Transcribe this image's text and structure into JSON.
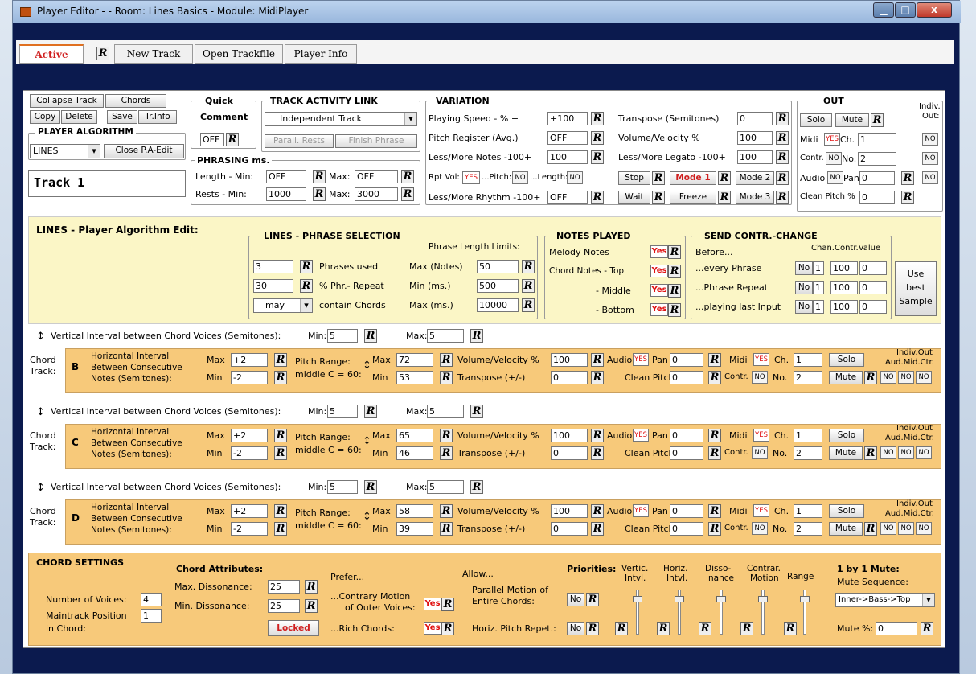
{
  "window": {
    "title": "Player Editor - - Room: Lines Basics - Module: MidiPlayer",
    "minimize": "▁",
    "maximize": "□",
    "close": "x"
  },
  "tabs": {
    "active": "Active",
    "r": "R",
    "new_track": "New Track",
    "open_trackfile": "Open Trackfile",
    "player_info": "Player Info"
  },
  "common": {
    "r": "R",
    "yes": "YES",
    "no": "NO",
    "Yes": "Yes",
    "No": "No"
  },
  "top": {
    "collapse": "Collapse Track",
    "chords": "Chords",
    "copy": "Copy",
    "delete": "Delete",
    "save": "Save",
    "trinfo": "Tr.Info",
    "algo_title": "PLAYER ALGORITHM",
    "algo_value": "LINES",
    "close_pa": "Close P.A-Edit",
    "track_name": "Track 1",
    "quick": "Quick",
    "comment": "Comment",
    "comment_val": "OFF",
    "tal_title": "TRACK ACTIVITY LINK",
    "tal_value": "Independent Track",
    "parall": "Parall. Rests",
    "finish": "Finish Phrase",
    "phr_title": "PHRASING ms.",
    "length": "Length - Min:",
    "rests": "Rests - Min:",
    "max": "Max:",
    "len_min": "OFF",
    "len_max": "OFF",
    "rest_min": "1000",
    "rest_max": "3000",
    "var_title": "VARIATION",
    "speed": "Playing Speed - % +",
    "speed_v": "+100",
    "pitchreg": "Pitch Register (Avg.)",
    "pitchreg_v": "OFF",
    "lessmore": "Less/More Notes -100+",
    "lessmore_v": "100",
    "rptvol": "Rpt Vol:",
    "pitch": "...Pitch:",
    "length2": "...Length:",
    "rhythm": "Less/More Rhythm -100+",
    "rhythm_v": "OFF",
    "transpose": "Transpose (Semitones)",
    "transpose_v": "0",
    "volvel": "Volume/Velocity %",
    "volvel_v": "100",
    "legato": "Less/More Legato -100+",
    "legato_v": "100",
    "stop": "Stop",
    "wait": "Wait",
    "mode1": "Mode 1",
    "freeze": "Freeze",
    "mode2": "Mode 2",
    "mode3": "Mode 3",
    "out_title": "OUT",
    "solo": "Solo",
    "mute": "Mute",
    "indiv": "Indiv.",
    "out2": "Out:",
    "midi": "Midi",
    "ch": "Ch.",
    "ch_v": "1",
    "contr": "Contr.",
    "no_l": "No.",
    "no_v": "2",
    "audio": "Audio",
    "pan": "Pan",
    "pan_v": "0",
    "cleanpitch": "Clean Pitch %",
    "cleanpitch_v": "0"
  },
  "lines": {
    "title": "LINES - Player Algorithm Edit:",
    "ps_title": "LINES - PHRASE SELECTION",
    "limits": "Phrase Length Limits:",
    "phrases_v": "3",
    "phrases": "Phrases used",
    "repeat_v": "30",
    "repeat": "% Phr.- Repeat",
    "may": "may",
    "contain": "contain Chords",
    "maxnotes": "Max (Notes)",
    "maxnotes_v": "50",
    "minms": "Min (ms.)",
    "minms_v": "500",
    "maxms": "Max (ms.)",
    "maxms_v": "10000",
    "np_title": "NOTES PLAYED",
    "melody": "Melody Notes",
    "top": "Chord Notes - Top",
    "middle": "- Middle",
    "bottom": "- Bottom",
    "sc_title": "SEND CONTR.-CHANGE",
    "before": "Before...",
    "chanhdr": "Chan.Contr.Value",
    "every": "...every Phrase",
    "prepeat": "...Phrase Repeat",
    "lastinput": "...playing last Input",
    "use": "Use",
    "best": "best",
    "sample": "Sample",
    "ch_v": "1",
    "contr_v": "100",
    "val_v": "0"
  },
  "vi": {
    "label": "Vertical Interval between Chord Voices (Semitones):",
    "min": "Min:",
    "max": "Max:"
  },
  "chordrow": {
    "chord": "Chord",
    "track": "Track:",
    "h1": "Horizontal Interval",
    "h2": "Between Consecutive",
    "h3": "Notes (Semitones):",
    "max": "Max",
    "min": "Min",
    "pr": "Pitch Range:",
    "middlec": "middle C = 60:",
    "vol": "Volume/Velocity %",
    "transp": "Transpose (+/-)",
    "audio": "Audio",
    "pan": "Pan",
    "clean": "Clean Pitch",
    "midi": "Midi",
    "ch": "Ch.",
    "contr": "Contr.",
    "no": "No.",
    "solo": "Solo",
    "mute": "Mute",
    "indivout": "Indiv.Out",
    "amc": "Aud.Mid.Ctr."
  },
  "tracks": [
    {
      "letter": "B",
      "vi_min": "5",
      "vi_max": "5",
      "hmax": "+2",
      "hmin": "-2",
      "pmax": "72",
      "pmin": "53",
      "vol": "100",
      "transp": "0",
      "pan": "0",
      "clean": "0",
      "ch": "1",
      "no": "2"
    },
    {
      "letter": "C",
      "vi_min": "5",
      "vi_max": "5",
      "hmax": "+2",
      "hmin": "-2",
      "pmax": "65",
      "pmin": "46",
      "vol": "100",
      "transp": "0",
      "pan": "0",
      "clean": "0",
      "ch": "1",
      "no": "2"
    },
    {
      "letter": "D",
      "vi_min": "5",
      "vi_max": "5",
      "hmax": "+2",
      "hmin": "-2",
      "pmax": "58",
      "pmin": "39",
      "vol": "100",
      "transp": "0",
      "pan": "0",
      "clean": "0",
      "ch": "1",
      "no": "2"
    }
  ],
  "cs": {
    "title": "CHORD SETTINGS",
    "voices": "Number of Voices:",
    "voices_v": "4",
    "mtp1": "Maintrack Position",
    "mtp_v": "1",
    "mtp2": "in Chord:",
    "attrs": "Chord Attributes:",
    "maxd": "Max. Dissonance:",
    "maxd_v": "25",
    "mind": "Min. Dissonance:",
    "mind_v": "25",
    "locked": "Locked",
    "prefer": "Prefer...",
    "contrary1": "...Contrary Motion",
    "contrary2": "of Outer Voices:",
    "rich": "...Rich Chords:",
    "allow": "Allow...",
    "parallel1": "Parallel Motion of",
    "parallel2": "Entire Chords:",
    "horizrep": "Horiz. Pitch Repet.:",
    "priorities": "Priorities:",
    "vert": "Vertic.",
    "vert2": "Intvl.",
    "horiz": "Horiz.",
    "horiz2": "Intvl.",
    "disso": "Disso-",
    "disso2": "nance",
    "contrar": "Contrar.",
    "contrar2": "Motion",
    "range": "Range",
    "onebyone": "1 by 1 Mute:",
    "muteseq": "Mute Sequence:",
    "muteseq_v": "Inner->Bass->Top",
    "mutepct": "Mute %:",
    "mutepct_v": "0"
  }
}
